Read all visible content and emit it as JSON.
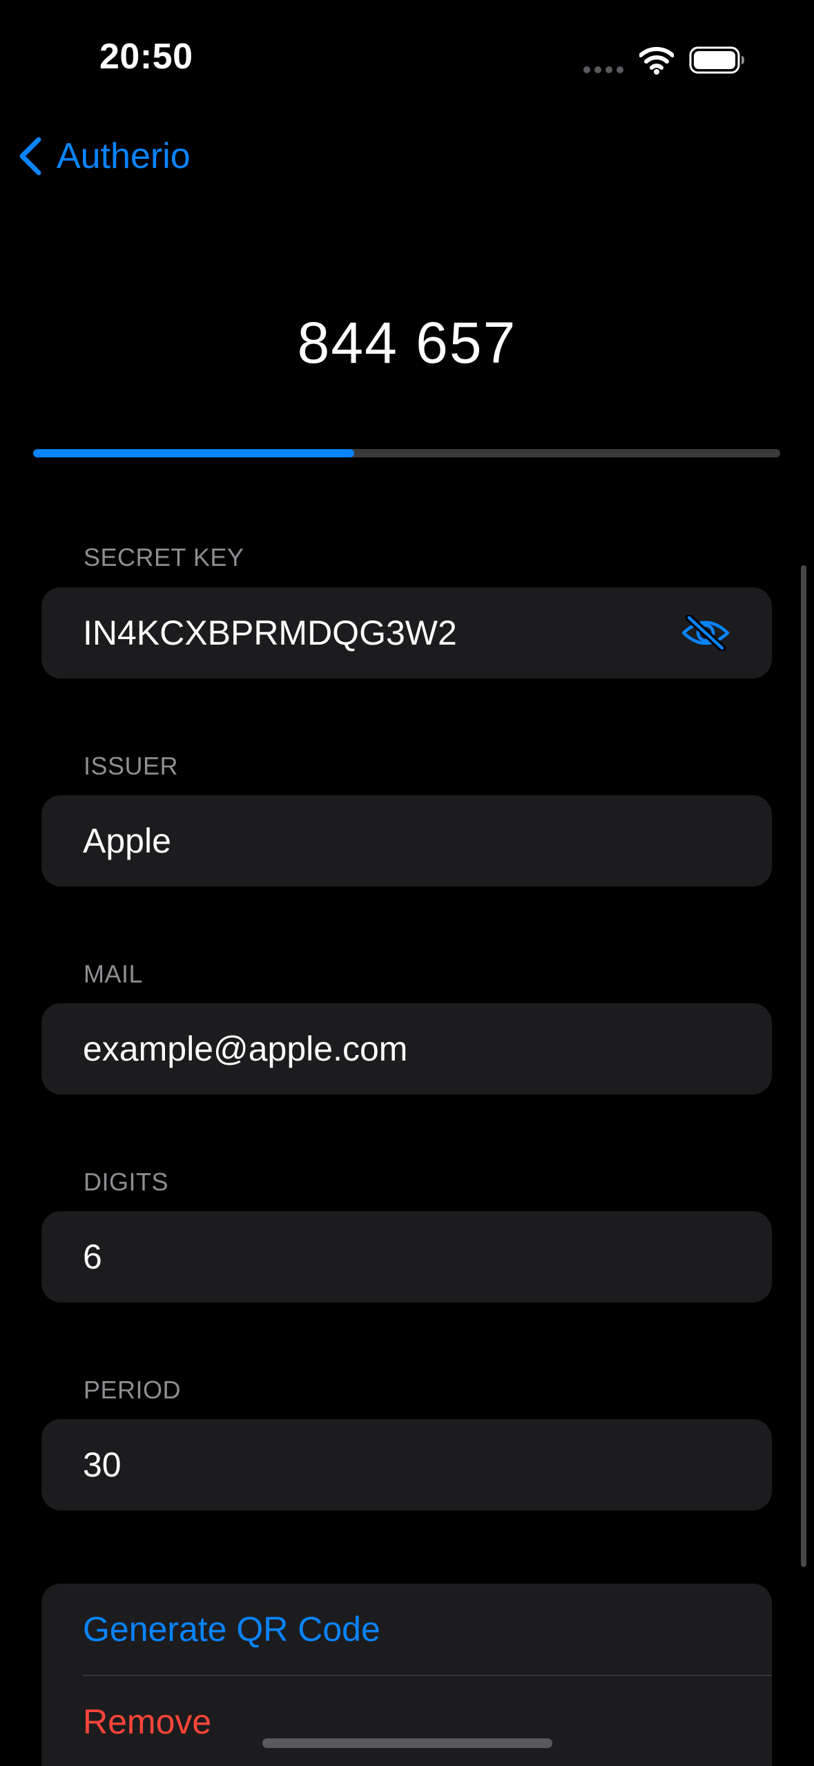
{
  "status_bar": {
    "time": "20:50"
  },
  "nav": {
    "back_label": "Autherio"
  },
  "otp": {
    "code": "844 657",
    "progress_fraction": 0.43
  },
  "fields": {
    "secret_key": {
      "label": "SECRET KEY",
      "value": "IN4KCXBPRMDQG3W2"
    },
    "issuer": {
      "label": "ISSUER",
      "value": "Apple"
    },
    "mail": {
      "label": "MAIL",
      "value": "example@apple.com"
    },
    "digits": {
      "label": "DIGITS",
      "value": "6"
    },
    "period": {
      "label": "PERIOD",
      "value": "30"
    }
  },
  "actions": {
    "generate_qr_label": "Generate QR Code",
    "remove_label": "Remove"
  },
  "icons": {
    "back": "chevron-left-icon",
    "visibility": "eye-slash-icon",
    "wifi": "wifi-icon",
    "battery": "battery-icon"
  },
  "colors": {
    "background": "#000000",
    "card": "#1c1c1e",
    "accent": "#0a84ff",
    "destructive": "#ff453a",
    "secondary_text": "#8e8e93"
  }
}
